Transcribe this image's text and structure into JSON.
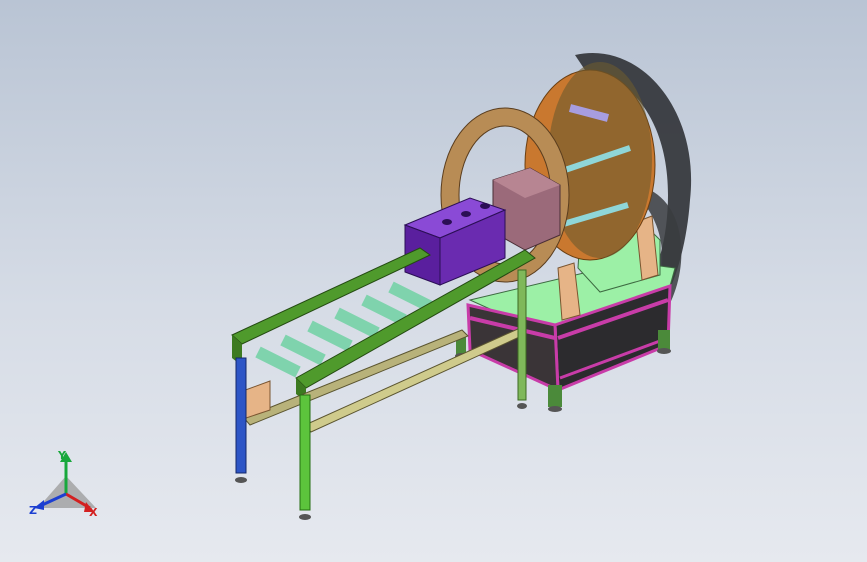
{
  "viewport": {
    "background_top": "#b9c4d4",
    "background_bottom": "#e6e9ef"
  },
  "triad": {
    "x_label": "X",
    "y_label": "Y",
    "z_label": "Z",
    "x_color": "#d32020",
    "y_color": "#18a83c",
    "z_color": "#1c3fd1"
  },
  "model": {
    "colors": {
      "conveyor_frame": "#4f9a2c",
      "roller": "#7fd3ad",
      "leg_blue": "#2d55c6",
      "leg_green": "#5cc43c",
      "ring": "#b88c55",
      "ring_drum": "#c9782f",
      "ring_shadow": "#303236",
      "block_purple": "#6a2bb0",
      "block_mauve": "#9b6a7a",
      "base_top": "#9cf0a6",
      "base_magenta": "#c83ca8",
      "base_panel": "#2c2b2e",
      "tan_bracket": "#e6b487",
      "rod": "#8fd6d8"
    }
  }
}
